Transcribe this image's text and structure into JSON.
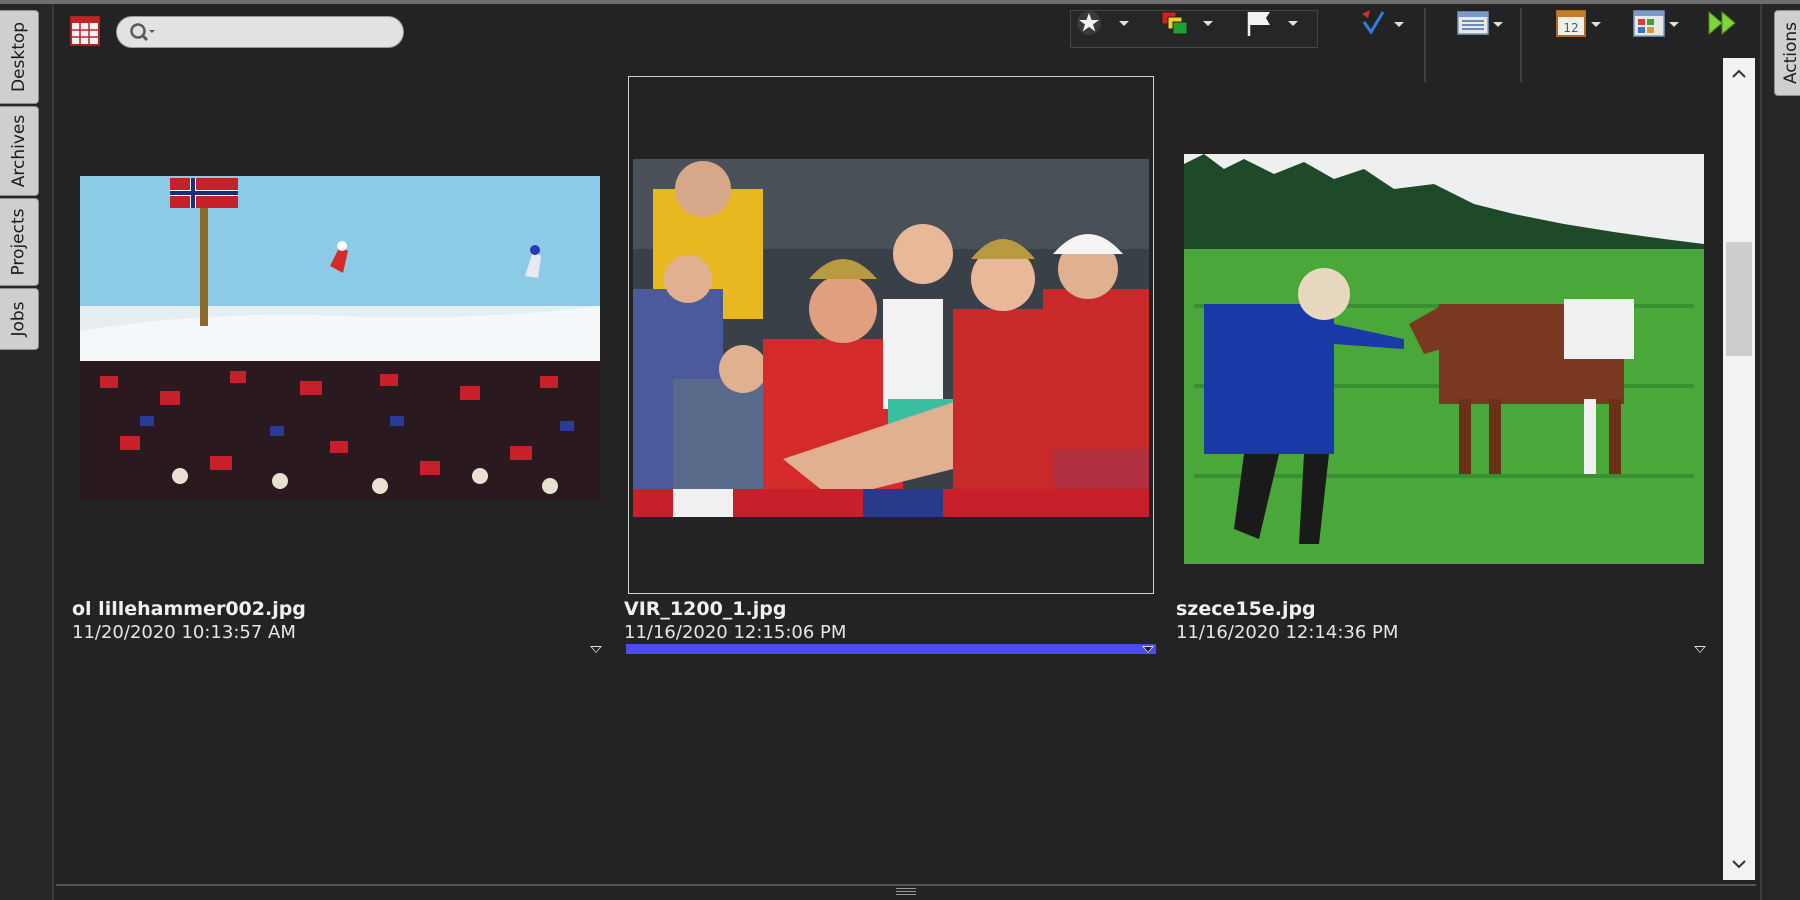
{
  "left_tabs": [
    "Desktop",
    "Archives",
    "Projects",
    "Jobs"
  ],
  "right_tabs": [
    "Actions"
  ],
  "search": {
    "value": "",
    "placeholder": ""
  },
  "toolbar": {
    "icons": [
      "grid-view-icon",
      "search-icon",
      "star-rating-icon",
      "color-label-icon",
      "flag-icon",
      "sort-icon",
      "list-view-icon",
      "calendar-icon",
      "layout-icon",
      "fast-forward-icon"
    ]
  },
  "items": [
    {
      "filename": "ol lillehammer002.jpg",
      "date": "11/20/2020 10:13:57 AM",
      "selected": false
    },
    {
      "filename": "VIR_1200_1.jpg",
      "date": "11/16/2020 12:15:06 PM",
      "selected": true
    },
    {
      "filename": "szece15e.jpg",
      "date": "11/16/2020 12:14:36 PM",
      "selected": false
    }
  ],
  "colors": {
    "background": "#232323",
    "selection": "#4b4bf0",
    "tab": "#cfcfcf"
  }
}
